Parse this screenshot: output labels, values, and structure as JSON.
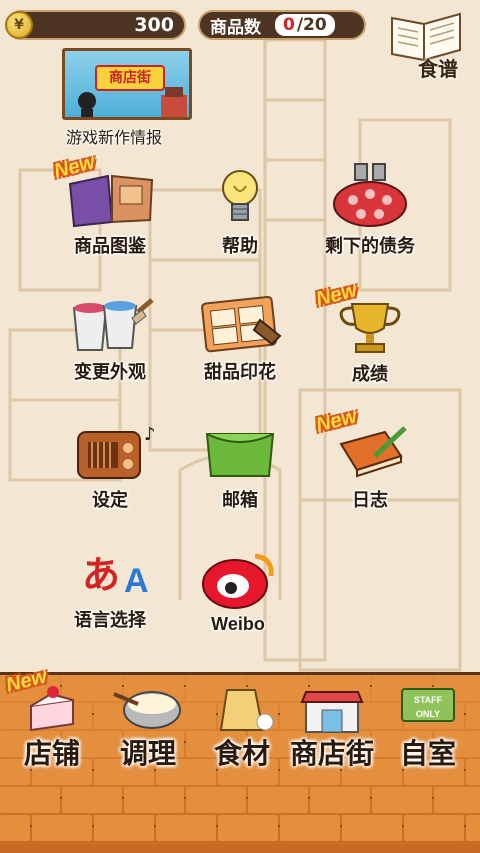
{
  "header": {
    "money_symbol": "¥",
    "money": "300",
    "item_count_label": "商品数",
    "item_count_current": "0",
    "item_count_max": "/20",
    "recipe_label": "食谱"
  },
  "ad": {
    "sign_text": "商店街",
    "label": "游戏新作情报"
  },
  "new_label": "New",
  "menu": {
    "catalog": "商品图鉴",
    "help": "帮助",
    "debt": "剩下的债务",
    "appearance": "变更外观",
    "stamp": "甜品印花",
    "achievements": "成绩",
    "settings": "设定",
    "mailbox": "邮箱",
    "diary": "日志",
    "language": "语言选择",
    "language_glyph1": "あ",
    "language_glyph2": "A",
    "weibo": "Weibo"
  },
  "nav": {
    "shop": "店铺",
    "cook": "调理",
    "ingredients": "食材",
    "street": "商店街",
    "home": "自室",
    "staff_sign": "STAFF ONLY"
  },
  "colors": {
    "pill_bg": "#4e3422",
    "red_accent": "#d42424",
    "new_yellow": "#ffda3a",
    "brick": "#e48f3e"
  }
}
